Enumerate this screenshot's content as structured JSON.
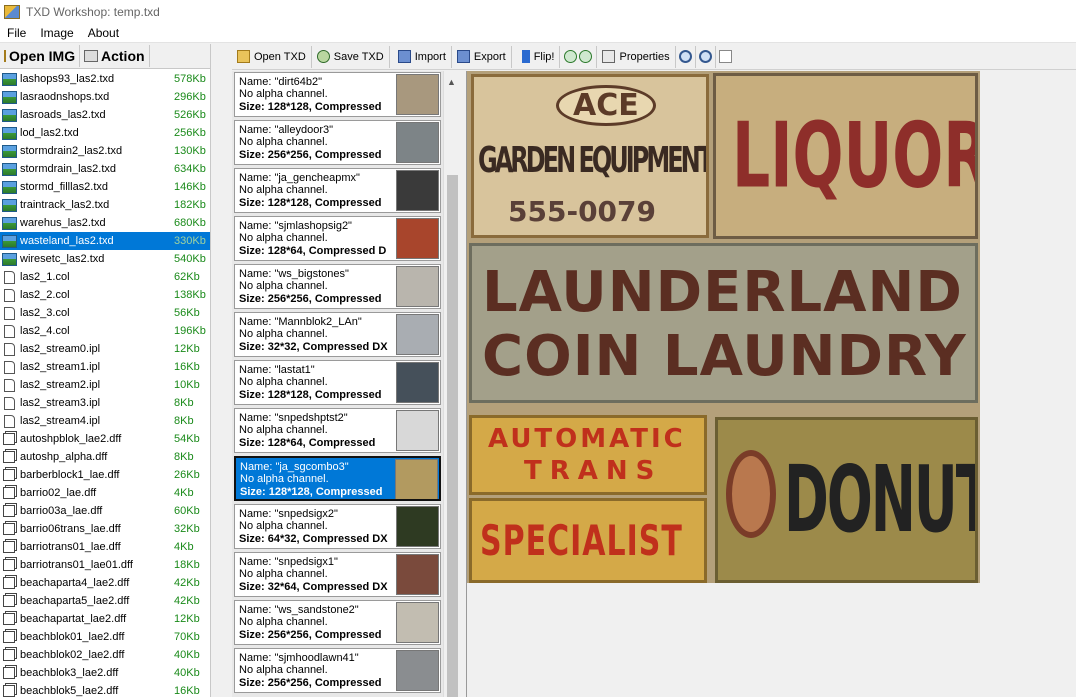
{
  "window": {
    "title": "TXD Workshop: temp.txd"
  },
  "menu": {
    "items": [
      "File",
      "Image",
      "About"
    ]
  },
  "left_toolbar": {
    "open_label": "Open IMG",
    "action_label": "Action"
  },
  "toolbar": {
    "open_txd": "Open TXD",
    "save_txd": "Save TXD",
    "import": "Import",
    "export": "Export",
    "flip": "Flip!",
    "properties": "Properties"
  },
  "files": [
    {
      "name": "lashops93_las2.txd",
      "size": "578Kb",
      "type": "txd"
    },
    {
      "name": "lasraodnshops.txd",
      "size": "296Kb",
      "type": "txd"
    },
    {
      "name": "lasroads_las2.txd",
      "size": "526Kb",
      "type": "txd"
    },
    {
      "name": "lod_las2.txd",
      "size": "256Kb",
      "type": "txd"
    },
    {
      "name": "stormdrain2_las2.txd",
      "size": "130Kb",
      "type": "txd"
    },
    {
      "name": "stormdrain_las2.txd",
      "size": "634Kb",
      "type": "txd"
    },
    {
      "name": "stormd_filllas2.txd",
      "size": "146Kb",
      "type": "txd"
    },
    {
      "name": "traintrack_las2.txd",
      "size": "182Kb",
      "type": "txd"
    },
    {
      "name": "warehus_las2.txd",
      "size": "680Kb",
      "type": "txd"
    },
    {
      "name": "wasteland_las2.txd",
      "size": "330Kb",
      "type": "txd",
      "selected": true
    },
    {
      "name": "wiresetc_las2.txd",
      "size": "540Kb",
      "type": "txd"
    },
    {
      "name": "las2_1.col",
      "size": "62Kb",
      "type": "doc"
    },
    {
      "name": "las2_2.col",
      "size": "138Kb",
      "type": "doc"
    },
    {
      "name": "las2_3.col",
      "size": "56Kb",
      "type": "doc"
    },
    {
      "name": "las2_4.col",
      "size": "196Kb",
      "type": "doc"
    },
    {
      "name": "las2_stream0.ipl",
      "size": "12Kb",
      "type": "doc"
    },
    {
      "name": "las2_stream1.ipl",
      "size": "16Kb",
      "type": "doc"
    },
    {
      "name": "las2_stream2.ipl",
      "size": "10Kb",
      "type": "doc"
    },
    {
      "name": "las2_stream3.ipl",
      "size": "8Kb",
      "type": "doc"
    },
    {
      "name": "las2_stream4.ipl",
      "size": "8Kb",
      "type": "doc"
    },
    {
      "name": "autoshpblok_lae2.dff",
      "size": "54Kb",
      "type": "cube"
    },
    {
      "name": "autoshp_alpha.dff",
      "size": "8Kb",
      "type": "cube"
    },
    {
      "name": "barberblock1_lae.dff",
      "size": "26Kb",
      "type": "cube"
    },
    {
      "name": "barrio02_lae.dff",
      "size": "4Kb",
      "type": "cube"
    },
    {
      "name": "barrio03a_lae.dff",
      "size": "60Kb",
      "type": "cube"
    },
    {
      "name": "barrio06trans_lae.dff",
      "size": "32Kb",
      "type": "cube"
    },
    {
      "name": "barriotrans01_lae.dff",
      "size": "4Kb",
      "type": "cube"
    },
    {
      "name": "barriotrans01_lae01.dff",
      "size": "18Kb",
      "type": "cube"
    },
    {
      "name": "beachaparta4_lae2.dff",
      "size": "42Kb",
      "type": "cube"
    },
    {
      "name": "beachaparta5_lae2.dff",
      "size": "42Kb",
      "type": "cube"
    },
    {
      "name": "beachapartat_lae2.dff",
      "size": "12Kb",
      "type": "cube"
    },
    {
      "name": "beachblok01_lae2.dff",
      "size": "70Kb",
      "type": "cube"
    },
    {
      "name": "beachblok02_lae2.dff",
      "size": "40Kb",
      "type": "cube"
    },
    {
      "name": "beachblok3_lae2.dff",
      "size": "40Kb",
      "type": "cube"
    },
    {
      "name": "beachblok5_lae2.dff",
      "size": "16Kb",
      "type": "cube"
    }
  ],
  "textures": [
    {
      "name": "Name: \"dirt64b2\"",
      "alpha": "No alpha channel.",
      "size": "Size: 128*128, Compressed",
      "thumb": "#a8987e"
    },
    {
      "name": "Name: \"alleydoor3\"",
      "alpha": "No alpha channel.",
      "size": "Size: 256*256, Compressed",
      "thumb": "#7d8487"
    },
    {
      "name": "Name: \"ja_gencheapmx\"",
      "alpha": "No alpha channel.",
      "size": "Size: 128*128, Compressed",
      "thumb": "#3a3a3a"
    },
    {
      "name": "Name: \"sjmlashopsig2\"",
      "alpha": "No alpha channel.",
      "size": "Size: 128*64, Compressed D",
      "thumb": "#a8452c"
    },
    {
      "name": "Name: \"ws_bigstones\"",
      "alpha": "No alpha channel.",
      "size": "Size: 256*256, Compressed",
      "thumb": "#b9b5ad"
    },
    {
      "name": "Name: \"Mannblok2_LAn\"",
      "alpha": "No alpha channel.",
      "size": "Size: 32*32, Compressed DX",
      "thumb": "#a9adb2"
    },
    {
      "name": "Name: \"lastat1\"",
      "alpha": "No alpha channel.",
      "size": "Size: 128*128, Compressed",
      "thumb": "#45505a"
    },
    {
      "name": "Name: \"snpedshptst2\"",
      "alpha": "No alpha channel.",
      "size": "Size: 128*64, Compressed",
      "thumb": "#d8d8d8"
    },
    {
      "name": "Name: \"ja_sgcombo3\"",
      "alpha": "No alpha channel.",
      "size": "Size: 128*128, Compressed",
      "thumb": "#b29a60",
      "selected": true
    },
    {
      "name": "Name: \"snpedsigx2\"",
      "alpha": "No alpha channel.",
      "size": "Size: 64*32, Compressed DX",
      "thumb": "#2e3a22"
    },
    {
      "name": "Name: \"snpedsigx1\"",
      "alpha": "No alpha channel.",
      "size": "Size: 32*64, Compressed DX",
      "thumb": "#7a4a3c"
    },
    {
      "name": "Name: \"ws_sandstone2\"",
      "alpha": "No alpha channel.",
      "size": "Size: 256*256, Compressed",
      "thumb": "#c2bdb1"
    },
    {
      "name": "Name: \"sjmhoodlawn41\"",
      "alpha": "No alpha channel.",
      "size": "Size: 256*256, Compressed",
      "thumb": "#8a8d90"
    }
  ],
  "preview": {
    "signs": {
      "garden_top": "ACE",
      "garden": "GARDEN EQUIPMENT",
      "garden_phone": "555-0079",
      "liquor": "LIQUOR",
      "launderland": "LAUNDERLAND",
      "coin_laundry": "COIN LAUNDRY",
      "automatic": "AUTOMATIC",
      "trans": "TRANS",
      "specialist": "SPECIALIST",
      "donuts": "DONUTS"
    }
  }
}
